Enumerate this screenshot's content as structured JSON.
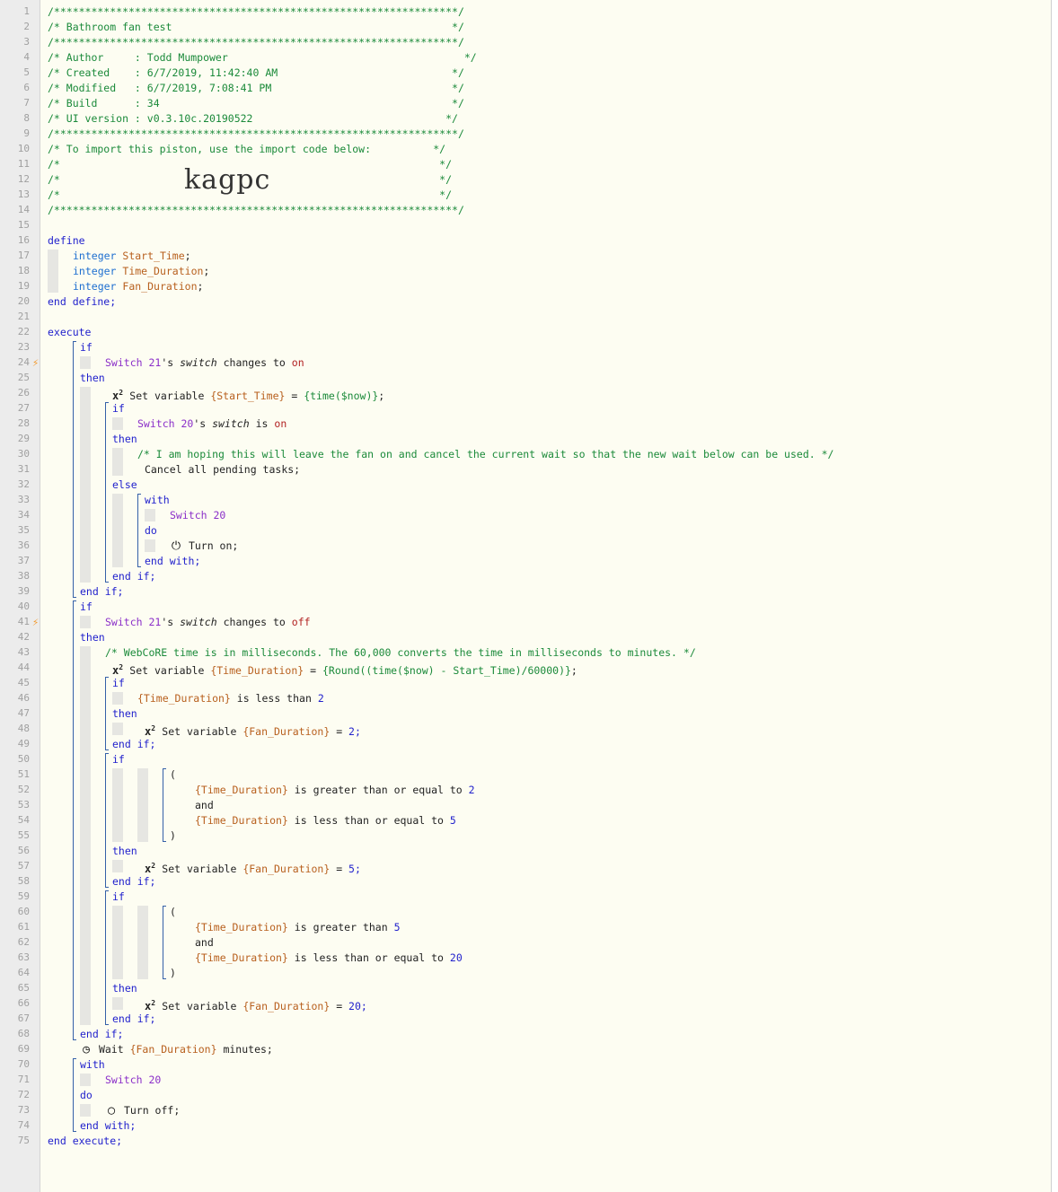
{
  "header": {
    "stars_line": "/*****************************************************************/",
    "title": "/* Bathroom fan test                                             */",
    "author": "/* Author     : Todd Mumpower                                      */",
    "created": "/* Created    : 6/7/2019, 11:42:40 AM                            */",
    "modified": "/* Modified   : 6/7/2019, 7:08:41 PM                             */",
    "build": "/* Build      : 34                                               */",
    "ui_version": "/* UI version : v0.3.10c.20190522                               */",
    "import_note": "/* To import this piston, use the import code below:          */",
    "blank_comment": "/*                                                             */",
    "import_code": "kagpc"
  },
  "code": {
    "define": "define",
    "integer": "integer",
    "var_start_time": "Start_Time",
    "var_time_duration": "Time_Duration",
    "var_fan_duration": "Fan_Duration",
    "end_define": "end define;",
    "execute": "execute",
    "end_execute": "end execute;",
    "if": "if",
    "then": "then",
    "else": "else",
    "end_if": "end if;",
    "with": "with",
    "do": "do",
    "end_with": "end with;",
    "and": "and",
    "semicolon": ";",
    "switch21": "Switch 21",
    "switch20": "Switch 20",
    "possessive": "'s",
    "switch_attr": "switch",
    "changes_to": "changes to",
    "is": "is",
    "on": "on",
    "off": "off",
    "set_variable": "Set variable",
    "start_time_var": "{Start_Time}",
    "time_duration_var": "{Time_Duration}",
    "fan_duration_var": "{Fan_Duration}",
    "equals": " = ",
    "time_now_expr": "{time($now)}",
    "round_expr": "{Round((time($now) - Start_Time)/60000)}",
    "comment_hoping": "/* I am hoping this will leave the fan on and cancel the current wait so that the new wait below can be used. */",
    "cancel_tasks": "Cancel all pending tasks;",
    "turn_on": "Turn on;",
    "turn_off": "Turn off;",
    "comment_webcore": "/* WebCoRE time is in milliseconds. The 60,000 converts the time in milliseconds to minutes. */",
    "is_less_than": "is less than",
    "is_gte": "is greater than or equal to",
    "is_lte": "is less than or equal to",
    "is_greater_than": "is greater than",
    "val_2": "2",
    "val_5": "5",
    "val_20": "20",
    "val_2s": "2;",
    "val_5s": "5;",
    "val_20s": "20;",
    "open_paren": "(",
    "close_paren": ")",
    "wait": "Wait",
    "minutes": "minutes;"
  },
  "line_count": 75,
  "colors": {
    "keyword": "#1e1ecc",
    "comment": "#1b8a3a",
    "variable": "#b8601e",
    "device": "#8b2fc9",
    "trigger_bolt": "#f29a2e",
    "editor_bg": "#fdfdf2"
  },
  "icons": {
    "trigger": "lightning-bolt-icon",
    "set_variable": "x-squared-icon",
    "turn_on": "power-icon",
    "turn_off": "power-off-icon",
    "wait": "clock-icon"
  }
}
